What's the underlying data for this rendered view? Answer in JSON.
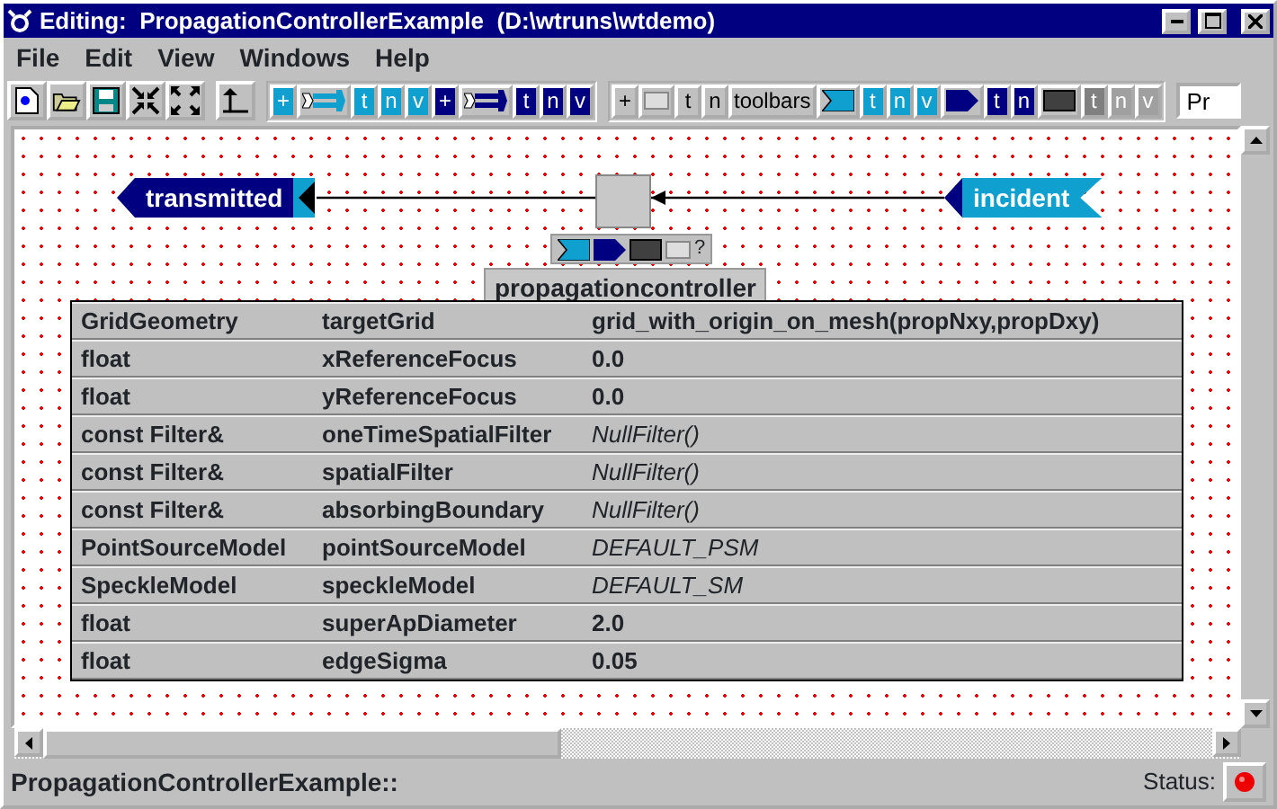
{
  "window": {
    "title": "Editing:  PropagationControllerExample  (D:\\wtruns\\wtdemo)"
  },
  "menu": [
    "File",
    "Edit",
    "View",
    "Windows",
    "Help"
  ],
  "toolbar": [
    [
      {
        "kind": "new"
      },
      {
        "kind": "open"
      },
      {
        "kind": "save"
      },
      {
        "kind": "collapse"
      },
      {
        "kind": "expand"
      }
    ],
    [
      {
        "kind": "up"
      }
    ],
    [
      {
        "kind": "letter",
        "label": "+",
        "color": "#10a0d0"
      },
      {
        "kind": "connector",
        "color": "#10a0d0"
      },
      {
        "kind": "letter",
        "label": "t",
        "color": "#10a0d0"
      },
      {
        "kind": "letter",
        "label": "n",
        "color": "#10a0d0"
      },
      {
        "kind": "letter",
        "label": "v",
        "color": "#10a0d0"
      },
      {
        "kind": "letter",
        "label": "+",
        "color": "#000080"
      },
      {
        "kind": "connector",
        "color": "#000080"
      },
      {
        "kind": "letter",
        "label": "t",
        "color": "#000080"
      },
      {
        "kind": "letter",
        "label": "n",
        "color": "#000080"
      },
      {
        "kind": "letter",
        "label": "v",
        "color": "#000080"
      }
    ],
    [
      {
        "kind": "letter",
        "label": "+",
        "color": "#c0c0c0"
      },
      {
        "kind": "blank"
      },
      {
        "kind": "letter",
        "label": "t",
        "color": "#c0c0c0"
      },
      {
        "kind": "letter",
        "label": "n",
        "color": "#c0c0c0"
      },
      {
        "kind": "letter",
        "label": "toolbars",
        "color": "#c0c0c0"
      },
      {
        "kind": "inport",
        "color": "#10a0d0"
      },
      {
        "kind": "letter",
        "label": "t",
        "color": "#10a0d0"
      },
      {
        "kind": "letter",
        "label": "n",
        "color": "#10a0d0"
      },
      {
        "kind": "letter",
        "label": "v",
        "color": "#10a0d0"
      },
      {
        "kind": "outport",
        "color": "#000080"
      },
      {
        "kind": "letter",
        "label": "t",
        "color": "#000080"
      },
      {
        "kind": "letter",
        "label": "n",
        "color": "#000080"
      },
      {
        "kind": "block"
      },
      {
        "kind": "letter",
        "label": "t",
        "color": "#808080"
      },
      {
        "kind": "letter",
        "label": "n",
        "color": "#a0a0a0"
      },
      {
        "kind": "letter",
        "label": "v",
        "color": "#a0a0a0"
      }
    ]
  ],
  "toolbar_field": {
    "value": "Pr"
  },
  "diagram": {
    "output_port": {
      "label": "transmitted"
    },
    "input_port": {
      "label": "incident"
    },
    "block_tools": [
      {
        "kind": "inport"
      },
      {
        "kind": "outport"
      },
      {
        "kind": "block"
      },
      {
        "kind": "blank"
      },
      {
        "kind": "help",
        "label": "?"
      }
    ],
    "block_name": "propagationcontroller",
    "parameters": [
      {
        "type": "GridGeometry",
        "name": "targetGrid",
        "value": "grid_with_origin_on_mesh(propNxy,propDxy)",
        "is_default": false
      },
      {
        "type": "float",
        "name": "xReferenceFocus",
        "value": "0.0",
        "is_default": false
      },
      {
        "type": "float",
        "name": "yReferenceFocus",
        "value": "0.0",
        "is_default": false
      },
      {
        "type": "const Filter&",
        "name": "oneTimeSpatialFilter",
        "value": "NullFilter()",
        "is_default": true
      },
      {
        "type": "const Filter&",
        "name": "spatialFilter",
        "value": "NullFilter()",
        "is_default": true
      },
      {
        "type": "const Filter&",
        "name": "absorbingBoundary",
        "value": "NullFilter()",
        "is_default": true
      },
      {
        "type": "PointSourceModel",
        "name": "pointSourceModel",
        "value": "DEFAULT_PSM",
        "is_default": true
      },
      {
        "type": "SpeckleModel",
        "name": "speckleModel",
        "value": "DEFAULT_SM",
        "is_default": true
      },
      {
        "type": "float",
        "name": "superApDiameter",
        "value": "2.0",
        "is_default": false
      },
      {
        "type": "float",
        "name": "edgeSigma",
        "value": "0.05",
        "is_default": false
      }
    ]
  },
  "status_bar": {
    "text": "PropagationControllerExample::",
    "label": "Status:"
  }
}
